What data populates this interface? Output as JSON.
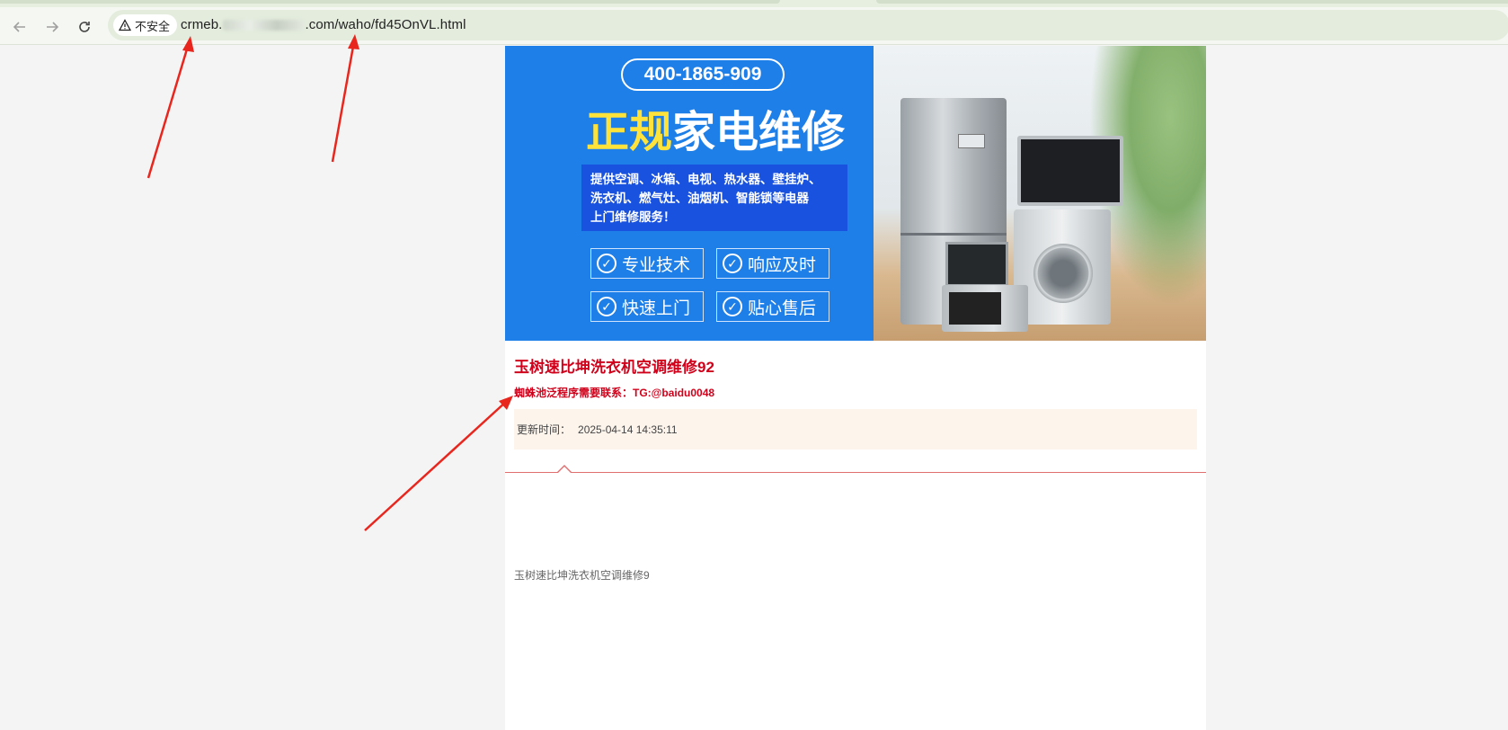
{
  "browser": {
    "back_icon": "arrow-left-icon",
    "forward_icon": "arrow-right-icon",
    "reload_icon": "reload-icon",
    "security_label": "不安全",
    "url_prefix": "crmeb.",
    "url_suffix": ".com/waho/fd45OnVL.html"
  },
  "banner": {
    "phone": "400-1865-909",
    "headline_highlight": "正规",
    "headline_rest": "家电维修",
    "description_lines": [
      "提供空调、冰箱、电视、热水器、壁挂炉、",
      "洗衣机、燃气灶、油烟机、智能锁等电器",
      "上门维修服务！"
    ],
    "features": [
      "专业技术",
      "响应及时",
      "快速上门",
      "贴心售后"
    ],
    "colors": {
      "blue": "#1f7fe8",
      "box_blue": "#1a52e0",
      "yellow": "#ffe33b"
    }
  },
  "article": {
    "title": "玉树速比坤洗衣机空调维修92",
    "contact": "蜘蛛池泛程序需要联系：TG:@baidu0048",
    "update_label": "更新时间：",
    "update_value": "2025-04-14 14:35:11",
    "body": "玉树速比坤洗衣机空调维修9",
    "accent_color": "#d0021b"
  }
}
